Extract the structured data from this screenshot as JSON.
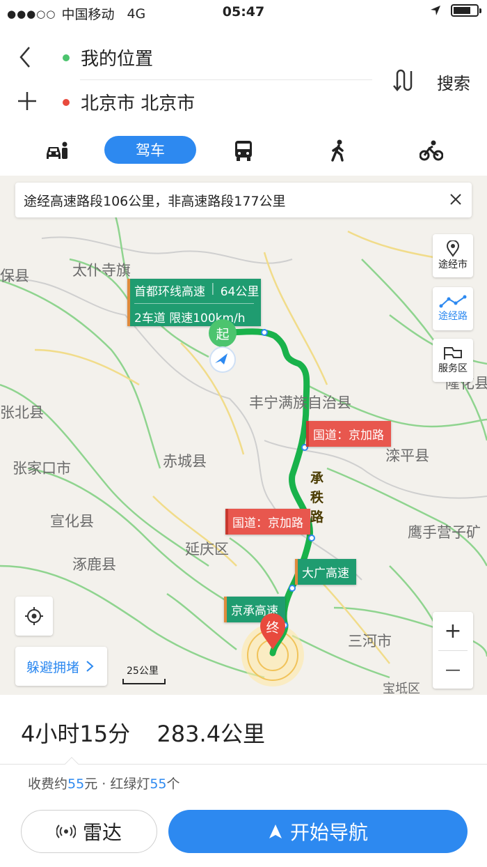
{
  "status": {
    "signal": "●●●○○",
    "carrier": "中国移动",
    "network": "4G",
    "time": "05:47"
  },
  "route": {
    "from": "我的位置",
    "to": "北京市 北京市",
    "search_label": "搜索"
  },
  "tabs": {
    "drive": "驾车"
  },
  "notice": {
    "text": "途经高速路段106公里，非高速路段177公里"
  },
  "map": {
    "labels": [
      "太仆寺旗",
      "保县",
      "丰宁满族自治县",
      "张北县",
      "张家口市",
      "赤城县",
      "滦平县",
      "宣化县",
      "延庆区",
      "涿鹿县",
      "鹰手营子矿",
      "三河市",
      "隆化县",
      "宝坻区"
    ],
    "tags": {
      "highway_name": "首都环线高速",
      "highway_len": "64公里",
      "highway_info": "2车道 限速100km/h",
      "national1": "国道：京加路",
      "national2": "国道：京加路",
      "daguang": "大广高速",
      "jingcheng": "京承高速"
    },
    "road_name_on_route": "承秩路",
    "start_marker": "起",
    "end_marker": "终",
    "side_buttons": {
      "via_city": "途经市",
      "via_road": "途经路",
      "service": "服务区"
    },
    "avoid_label": "躲避拥堵",
    "scale_label": "25公里",
    "zoom_in": "+",
    "zoom_out": "—"
  },
  "summary": {
    "duration": "4小时15分",
    "distance": "283.4公里"
  },
  "fee": {
    "prefix": "收费约",
    "toll": "55",
    "mid": "元 · 红绿灯",
    "lights": "55",
    "suffix": "个"
  },
  "actions": {
    "radar": "雷达",
    "navigate": "开始导航"
  },
  "colors": {
    "accent": "#2d89f0",
    "route_green": "#19b24b",
    "tag_red": "#e8574e",
    "tag_green": "#1f9c70"
  }
}
